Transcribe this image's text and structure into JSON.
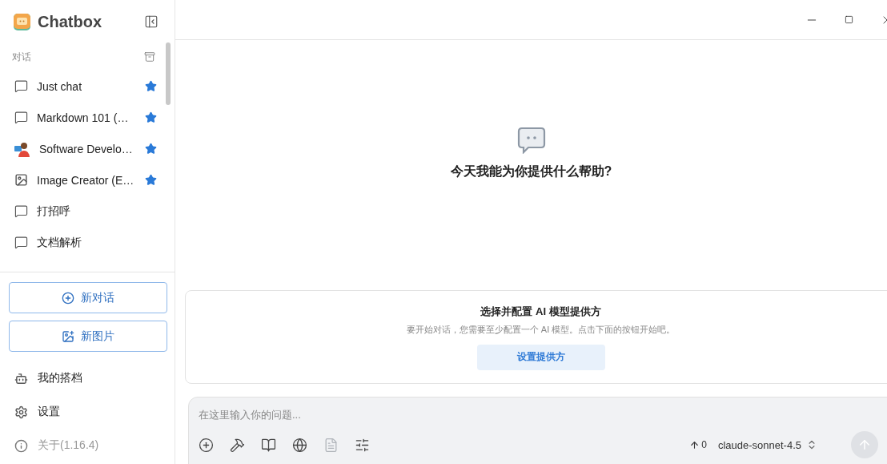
{
  "app": {
    "name": "Chatbox"
  },
  "sidebar": {
    "section_label": "对话",
    "conversations": [
      {
        "title": "Just chat",
        "kind": "chat",
        "starred": true
      },
      {
        "title": "Markdown 101 (…",
        "kind": "chat",
        "starred": true
      },
      {
        "title": "Software Develo…",
        "kind": "avatar",
        "starred": true
      },
      {
        "title": "Image Creator (E…",
        "kind": "image",
        "starred": true
      },
      {
        "title": "打招呼",
        "kind": "chat",
        "starred": false
      },
      {
        "title": "文档解析",
        "kind": "chat",
        "starred": false
      }
    ],
    "buttons": [
      {
        "label": "新对话",
        "kind": "chat"
      },
      {
        "label": "新图片",
        "kind": "image"
      }
    ],
    "menu": [
      {
        "label": "我的搭档",
        "kind": "partners"
      },
      {
        "label": "设置",
        "kind": "settings"
      },
      {
        "label": "关于(1.16.4)",
        "kind": "about"
      }
    ]
  },
  "welcome": {
    "heading": "今天我能为你提供什么帮助?"
  },
  "provider_card": {
    "title": "选择并配置 AI 模型提供方",
    "description": "要开始对话，您需要至少配置一个 AI 模型。点击下面的按钮开始吧。",
    "button": "设置提供方"
  },
  "composer": {
    "placeholder": "在这里输入你的问题...",
    "token_count": "0",
    "model": "claude-sonnet-4.5"
  }
}
